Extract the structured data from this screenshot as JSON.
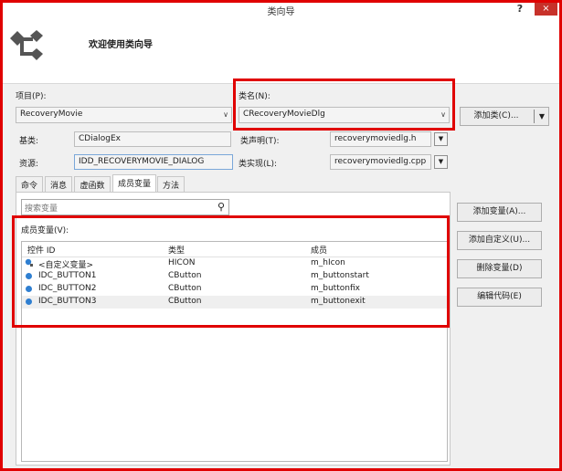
{
  "window": {
    "title": "类向导",
    "help": "?",
    "close": "×"
  },
  "header": {
    "welcome": "欢迎使用类向导"
  },
  "form": {
    "project_label": "项目(P):",
    "project_value": "RecoveryMovie",
    "classname_label": "类名(N):",
    "classname_value": "CRecoveryMovieDlg",
    "add_class_label": "添加类(C)...",
    "base_label": "基类:",
    "base_value": "CDialogEx",
    "decl_label": "类声明(T):",
    "decl_value": "recoverymoviedlg.h",
    "resource_label": "资源:",
    "resource_value": "IDD_RECOVERYMOVIE_DIALOG",
    "impl_label": "类实现(L):",
    "impl_value": "recoverymoviedlg.cpp"
  },
  "tabs": [
    {
      "label": "命令"
    },
    {
      "label": "消息"
    },
    {
      "label": "虚函数"
    },
    {
      "label": "成员变量"
    },
    {
      "label": "方法"
    }
  ],
  "active_tab": "成员变量",
  "members": {
    "search_placeholder": "搜索变量",
    "list_label": "成员变量(V):",
    "columns": [
      "控件 ID",
      "类型",
      "成员"
    ],
    "rows": [
      {
        "id": "<自定义变量>",
        "type": "HICON",
        "member": "m_hIcon",
        "icon": "custom-variable-icon"
      },
      {
        "id": "IDC_BUTTON1",
        "type": "CButton",
        "member": "m_buttonstart",
        "icon": "variable-icon"
      },
      {
        "id": "IDC_BUTTON2",
        "type": "CButton",
        "member": "m_buttonfix",
        "icon": "variable-icon"
      },
      {
        "id": "IDC_BUTTON3",
        "type": "CButton",
        "member": "m_buttonexit",
        "icon": "variable-icon"
      }
    ]
  },
  "actions": {
    "add_variable": "添加变量(A)...",
    "add_custom": "添加自定义(U)...",
    "delete_variable": "删除变量(D)",
    "edit_code": "编辑代码(E)"
  },
  "colors": {
    "highlight": "#e00000",
    "close_button": "#c7312a",
    "icon_blue": "#2f7fd1"
  }
}
